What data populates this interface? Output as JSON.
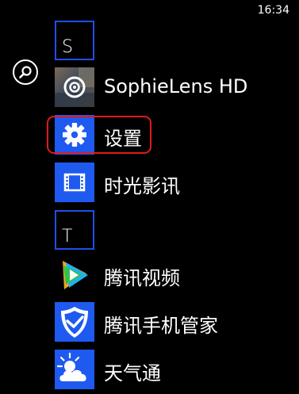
{
  "status": {
    "time": "16:34"
  },
  "search": {
    "icon": "search-icon"
  },
  "groups": {
    "s": {
      "letter": "S"
    },
    "t": {
      "letter": "T"
    }
  },
  "apps": {
    "sophielens": {
      "label": "SophieLens HD",
      "icon": "camera-lens-icon"
    },
    "settings": {
      "label": "设置",
      "icon": "gear-icon",
      "color": "#1f5af0"
    },
    "video": {
      "label": "时光影讯",
      "icon": "film-strip-icon",
      "color": "#1f5af0"
    },
    "tencent_video": {
      "label": "腾讯视频",
      "icon": "tencent-video-play-icon"
    },
    "tencent_guard": {
      "label": "腾讯手机管家",
      "icon": "shield-check-icon",
      "color": "#1f5af0"
    },
    "weather": {
      "label": "天气通",
      "icon": "weather-cloud-sun-icon",
      "color": "#1f5af0"
    }
  },
  "colors": {
    "accent": "#1f4fe8",
    "highlight": "#e01a1a",
    "background": "#000000"
  }
}
